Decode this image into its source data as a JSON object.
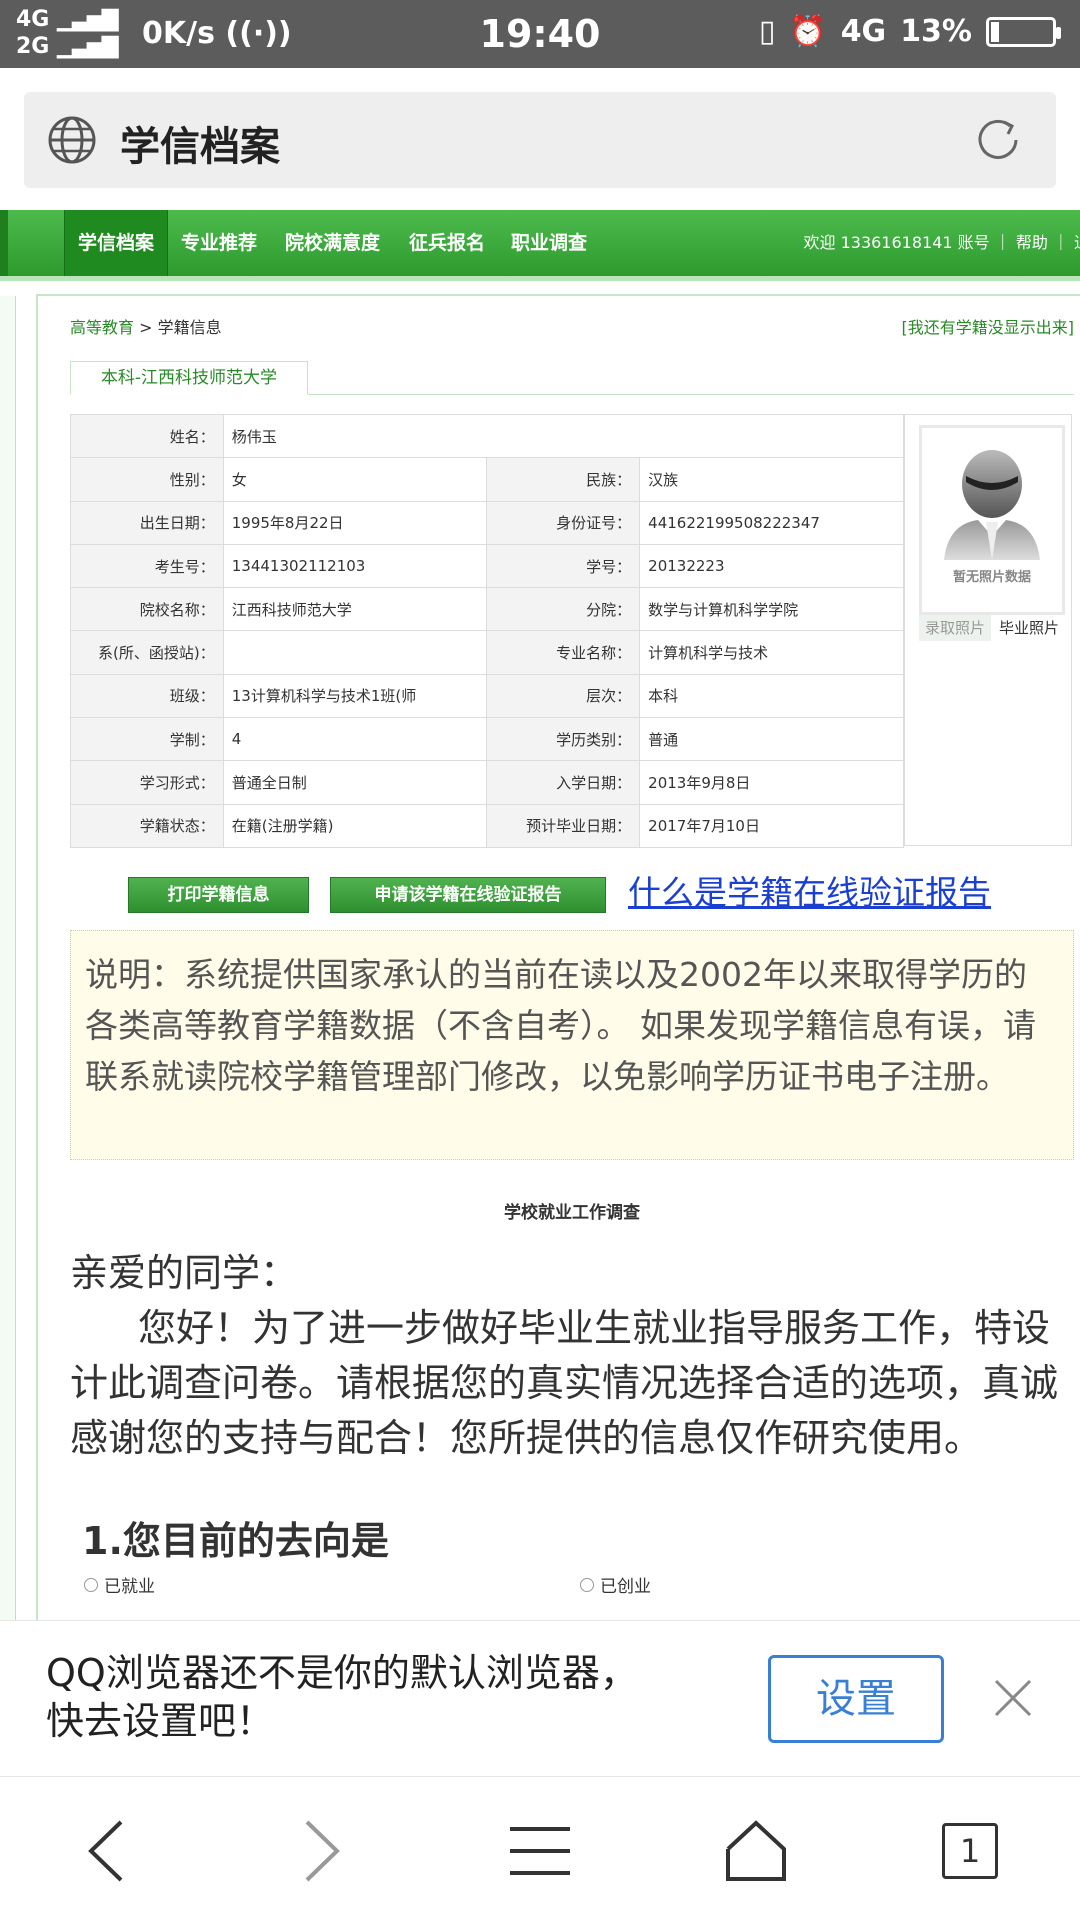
{
  "status_bar": {
    "network_top": "4G",
    "network_bottom": "2G",
    "speed": "0K/s",
    "time": "19:40",
    "network_right": "4G",
    "battery": "13%",
    "battery_level": 0.13
  },
  "address_bar": {
    "title": "学信档案"
  },
  "nav": {
    "items": [
      "学信档案",
      "专业推荐",
      "院校满意度",
      "征兵报名",
      "职业调查"
    ],
    "welcome": "欢迎 13361618141 账号 ｜ 帮助 ｜ 退"
  },
  "breadcrumb": {
    "home": "高等教育",
    "sep": " > ",
    "current": "学籍信息",
    "right_link": "[我还有学籍没显示出来]"
  },
  "record_tab": "本科-江西科技师范大学",
  "table": {
    "name_label": "姓名：",
    "name": "杨伟玉",
    "gender_label": "性别：",
    "gender": "女",
    "ethnic_label": "民族：",
    "ethnic": "汉族",
    "birth_label": "出生日期：",
    "birth": "1995年8月22日",
    "id_label": "身份证号：",
    "id": "441622199508222347",
    "exam_label": "考生号：",
    "exam": "13441302112103",
    "sno_label": "学号：",
    "sno": "20132223",
    "school_label": "院校名称：",
    "school": "江西科技师范大学",
    "college_label": "分院：",
    "college": "数学与计算机科学学院",
    "dept_label": "系(所、函授站)：",
    "dept": "",
    "major_label": "专业名称：",
    "major": "计算机科学与技术",
    "class_label": "班级：",
    "class": "13计算机科学与技术1班(师",
    "level_label": "层次：",
    "level": "本科",
    "years_label": "学制：",
    "years": "4",
    "degree_type_label": "学历类别：",
    "degree_type": "普通",
    "form_label": "学习形式：",
    "form": "普通全日制",
    "enroll_label": "入学日期：",
    "enroll": "2013年9月8日",
    "status_label": "学籍状态：",
    "status": "在籍(注册学籍)",
    "grad_label": "预计毕业日期：",
    "grad": "2017年7月10日"
  },
  "photo": {
    "caption": "暂无照片数据",
    "tab_admission": "录取照片",
    "tab_graduation": "毕业照片"
  },
  "buttons": {
    "print": "打印学籍信息",
    "apply": "申请该学籍在线验证报告",
    "what_is": "什么是学籍在线验证报告"
  },
  "note": "说明：系统提供国家承认的当前在读以及2002年以来取得学历的各类高等教育学籍数据（不含自考）。  如果发现学籍信息有误，请联系就读院校学籍管理部门修改，以免影响学历证书电子注册。",
  "survey": {
    "title": "学校就业工作调查",
    "greeting": "亲爱的同学：",
    "body": "您好！为了进一步做好毕业生就业指导服务工作，特设计此调查问卷。请根据您的真实情况选择合适的选项，真诚感谢您的支持与配合！您所提供的信息仅作研究使用。",
    "q1": "1.您目前的去向是",
    "opt1": "已就业",
    "opt2": "已创业"
  },
  "banner": {
    "message_line1": "QQ浏览器还不是你的默认浏览器，",
    "message_line2": "快去设置吧！",
    "set_button": "设置"
  },
  "toolbar": {
    "tab_count": "1"
  }
}
